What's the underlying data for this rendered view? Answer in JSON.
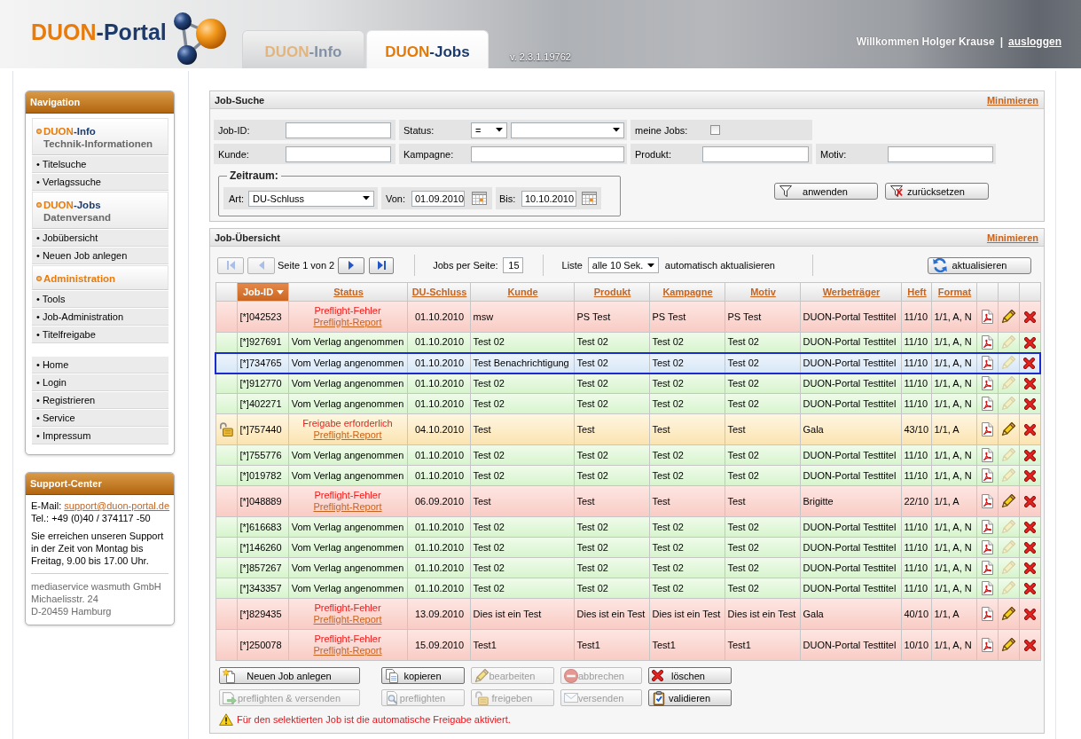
{
  "header": {
    "logo_brand": "DUON",
    "logo_rest": "-Portal",
    "tabs": [
      {
        "brand": "DUON",
        "label": "-Info",
        "selected": false
      },
      {
        "brand": "DUON",
        "label": "-Jobs",
        "selected": true
      }
    ],
    "version": "v. 2.3.1.19762",
    "welcome": "Willkommen Holger Krause",
    "divider": "|",
    "logout": "ausloggen"
  },
  "navigation": {
    "title": "Navigation",
    "groups": [
      {
        "brand": "DUON",
        "title": "-Info",
        "subtitle": "Technik-Informationen",
        "items": [
          "• Titelsuche",
          "• Verlagssuche"
        ]
      },
      {
        "brand": "DUON",
        "title": "-Jobs",
        "subtitle": "Datenversand",
        "items": [
          "• Jobübersicht",
          "• Neuen Job anlegen"
        ]
      },
      {
        "title": "Administration",
        "items": [
          "• Tools",
          "• Job-Administration",
          "• Titelfreigabe"
        ]
      },
      {
        "items": [
          "• Home",
          "• Login",
          "• Registrieren",
          "• Service",
          "• Impressum"
        ]
      }
    ]
  },
  "support": {
    "title": "Support-Center",
    "email_label": "E-Mail:",
    "email": "support@duon-portal.de",
    "phone": "Tel.: +49 (0)40 / 374117 -50",
    "hours": [
      "Sie erreichen unseren Support",
      "in der Zeit von Montag bis",
      "Freitag, 9.00 bis 17.00 Uhr."
    ],
    "address": [
      "mediaservice wasmuth GmbH",
      "Michaelisstr. 24",
      "D-20459 Hamburg"
    ]
  },
  "search": {
    "title": "Job-Suche",
    "minimize": "Minimieren",
    "job_id_label": "Job-ID:",
    "status_label": "Status:",
    "status_operator": "=",
    "my_jobs_label": "meine Jobs:",
    "my_jobs_checked": false,
    "customer_label": "Kunde:",
    "campaign_label": "Kampagne:",
    "product_label": "Produkt:",
    "motif_label": "Motiv:",
    "period": {
      "legend": "Zeitraum:",
      "type_label": "Art:",
      "type_value": "DU-Schluss",
      "from_label": "Von:",
      "from_value": "01.09.2010",
      "to_label": "Bis:",
      "to_value": "10.10.2010"
    },
    "apply": "anwenden",
    "reset": "zurücksetzen"
  },
  "jobs": {
    "title": "Job-Übersicht",
    "minimize": "Minimieren",
    "pager": {
      "first_disabled": true,
      "previous_disabled": true,
      "page": "Seite 1 von 2",
      "next_disabled": false,
      "last_disabled": false
    },
    "per_page_label": "Jobs per Seite:",
    "per_page": "15",
    "list_label": "Liste",
    "refresh_interval": "alle 10 Sek.",
    "auto_refresh_label": "automatisch aktualisieren",
    "refresh_button": "aktualisieren",
    "columns": [
      {
        "label": "Job-ID",
        "sorted": true
      },
      {
        "label": "Status",
        "sorted": false
      },
      {
        "label": "DU-Schluss",
        "sorted": false
      },
      {
        "label": "Kunde",
        "sorted": false
      },
      {
        "label": "Produkt",
        "sorted": false
      },
      {
        "label": "Kampagne",
        "sorted": false
      },
      {
        "label": "Motiv",
        "sorted": false
      },
      {
        "label": "Werbeträger",
        "sorted": false
      },
      {
        "label": "Heft",
        "sorted": false
      },
      {
        "label": "Format",
        "sorted": false
      }
    ],
    "rows": [
      {
        "kind": "error",
        "selected": false,
        "locked": false,
        "editable": true,
        "job_id": "[*]042523",
        "status": "Preflight-Fehler",
        "status_link": "Preflight-Report",
        "du_schluss": "01.10.2010",
        "kunde": "msw",
        "produkt": "PS Test",
        "kampagne": "PS Test",
        "motiv": "PS Test",
        "werbetraeger": "DUON-Portal Testtitel",
        "heft": "11/10",
        "format": "1/1, A, N"
      },
      {
        "kind": "accepted",
        "selected": false,
        "locked": false,
        "editable": false,
        "job_id": "[*]927691",
        "status": "Vom Verlag angenommen",
        "du_schluss": "01.10.2010",
        "kunde": "Test 02",
        "produkt": "Test 02",
        "kampagne": "Test 02",
        "motiv": "Test 02",
        "werbetraeger": "DUON-Portal Testtitel",
        "heft": "11/10",
        "format": "1/1, A, N"
      },
      {
        "kind": "accepted",
        "selected": true,
        "locked": false,
        "editable": false,
        "job_id": "[*]734765",
        "status": "Vom Verlag angenommen",
        "du_schluss": "01.10.2010",
        "kunde": "Test Benachrichtigung",
        "produkt": "Test 02",
        "kampagne": "Test 02",
        "motiv": "Test 02",
        "werbetraeger": "DUON-Portal Testtitel",
        "heft": "11/10",
        "format": "1/1, A, N"
      },
      {
        "kind": "accepted",
        "selected": false,
        "locked": false,
        "editable": false,
        "job_id": "[*]912770",
        "status": "Vom Verlag angenommen",
        "du_schluss": "01.10.2010",
        "kunde": "Test 02",
        "produkt": "Test 02",
        "kampagne": "Test 02",
        "motiv": "Test 02",
        "werbetraeger": "DUON-Portal Testtitel",
        "heft": "11/10",
        "format": "1/1, A, N"
      },
      {
        "kind": "accepted",
        "selected": false,
        "locked": false,
        "editable": false,
        "job_id": "[*]402271",
        "status": "Vom Verlag angenommen",
        "du_schluss": "01.10.2010",
        "kunde": "Test 02",
        "produkt": "Test 02",
        "kampagne": "Test 02",
        "motiv": "Test 02",
        "werbetraeger": "DUON-Portal Testtitel",
        "heft": "11/10",
        "format": "1/1, A, N"
      },
      {
        "kind": "approval",
        "selected": false,
        "locked": true,
        "editable": true,
        "job_id": "[*]757440",
        "status": "Freigabe erforderlich",
        "status_link": "Preflight-Report",
        "du_schluss": "04.10.2010",
        "kunde": "Test",
        "produkt": "Test",
        "kampagne": "Test",
        "motiv": "Test",
        "werbetraeger": "Gala",
        "heft": "43/10",
        "format": "1/1, A"
      },
      {
        "kind": "accepted",
        "selected": false,
        "locked": false,
        "editable": false,
        "job_id": "[*]755776",
        "status": "Vom Verlag angenommen",
        "du_schluss": "01.10.2010",
        "kunde": "Test 02",
        "produkt": "Test 02",
        "kampagne": "Test 02",
        "motiv": "Test 02",
        "werbetraeger": "DUON-Portal Testtitel",
        "heft": "11/10",
        "format": "1/1, A, N"
      },
      {
        "kind": "accepted",
        "selected": false,
        "locked": false,
        "editable": false,
        "job_id": "[*]019782",
        "status": "Vom Verlag angenommen",
        "du_schluss": "01.10.2010",
        "kunde": "Test 02",
        "produkt": "Test 02",
        "kampagne": "Test 02",
        "motiv": "Test 02",
        "werbetraeger": "DUON-Portal Testtitel",
        "heft": "11/10",
        "format": "1/1, A, N"
      },
      {
        "kind": "error",
        "selected": false,
        "locked": false,
        "editable": true,
        "job_id": "[*]048889",
        "status": "Preflight-Fehler",
        "status_link": "Preflight-Report",
        "du_schluss": "06.09.2010",
        "kunde": "Test",
        "produkt": "Test",
        "kampagne": "Test",
        "motiv": "Test",
        "werbetraeger": "Brigitte",
        "heft": "22/10",
        "format": "1/1, A"
      },
      {
        "kind": "accepted",
        "selected": false,
        "locked": false,
        "editable": false,
        "job_id": "[*]616683",
        "status": "Vom Verlag angenommen",
        "du_schluss": "01.10.2010",
        "kunde": "Test 02",
        "produkt": "Test 02",
        "kampagne": "Test 02",
        "motiv": "Test 02",
        "werbetraeger": "DUON-Portal Testtitel",
        "heft": "11/10",
        "format": "1/1, A, N"
      },
      {
        "kind": "accepted",
        "selected": false,
        "locked": false,
        "editable": false,
        "job_id": "[*]146260",
        "status": "Vom Verlag angenommen",
        "du_schluss": "01.10.2010",
        "kunde": "Test 02",
        "produkt": "Test 02",
        "kampagne": "Test 02",
        "motiv": "Test 02",
        "werbetraeger": "DUON-Portal Testtitel",
        "heft": "11/10",
        "format": "1/1, A, N"
      },
      {
        "kind": "accepted",
        "selected": false,
        "locked": false,
        "editable": false,
        "job_id": "[*]857267",
        "status": "Vom Verlag angenommen",
        "du_schluss": "01.10.2010",
        "kunde": "Test 02",
        "produkt": "Test 02",
        "kampagne": "Test 02",
        "motiv": "Test 02",
        "werbetraeger": "DUON-Portal Testtitel",
        "heft": "11/10",
        "format": "1/1, A, N"
      },
      {
        "kind": "accepted",
        "selected": false,
        "locked": false,
        "editable": false,
        "job_id": "[*]343357",
        "status": "Vom Verlag angenommen",
        "du_schluss": "01.10.2010",
        "kunde": "Test 02",
        "produkt": "Test 02",
        "kampagne": "Test 02",
        "motiv": "Test 02",
        "werbetraeger": "DUON-Portal Testtitel",
        "heft": "11/10",
        "format": "1/1, A, N"
      },
      {
        "kind": "error",
        "selected": false,
        "locked": false,
        "editable": true,
        "job_id": "[*]829435",
        "status": "Preflight-Fehler",
        "status_link": "Preflight-Report",
        "du_schluss": "13.09.2010",
        "kunde": "Dies ist ein Test",
        "produkt": "Dies ist ein Test",
        "kampagne": "Dies ist ein Test",
        "motiv": "Dies ist ein Test",
        "werbetraeger": "Gala",
        "heft": "40/10",
        "format": "1/1, A"
      },
      {
        "kind": "error",
        "selected": false,
        "locked": false,
        "editable": true,
        "job_id": "[*]250078",
        "status": "Preflight-Fehler",
        "status_link": "Preflight-Report",
        "du_schluss": "15.09.2010",
        "kunde": "Test1",
        "produkt": "Test1",
        "kampagne": "Test1",
        "motiv": "Test1",
        "werbetraeger": "DUON-Portal Testtitel",
        "heft": "10/10",
        "format": "1/1, A, N"
      }
    ],
    "actions": [
      {
        "buttons": [
          {
            "label": "Neuen Job anlegen",
            "disabled": false
          },
          {
            "label": "kopieren",
            "disabled": false
          },
          {
            "label": "bearbeiten",
            "disabled": true
          },
          {
            "label": "abbrechen",
            "disabled": true
          },
          {
            "label": "löschen",
            "disabled": false
          }
        ]
      },
      {
        "buttons": [
          {
            "label": "preflighten & versenden",
            "disabled": true
          },
          {
            "label": "preflighten",
            "disabled": true
          },
          {
            "label": "freigeben",
            "disabled": true
          },
          {
            "label": "versenden",
            "disabled": true
          },
          {
            "label": "validieren",
            "disabled": false
          }
        ]
      }
    ],
    "notice": "Für den selektierten Job ist die automatische Freigabe aktiviert."
  }
}
